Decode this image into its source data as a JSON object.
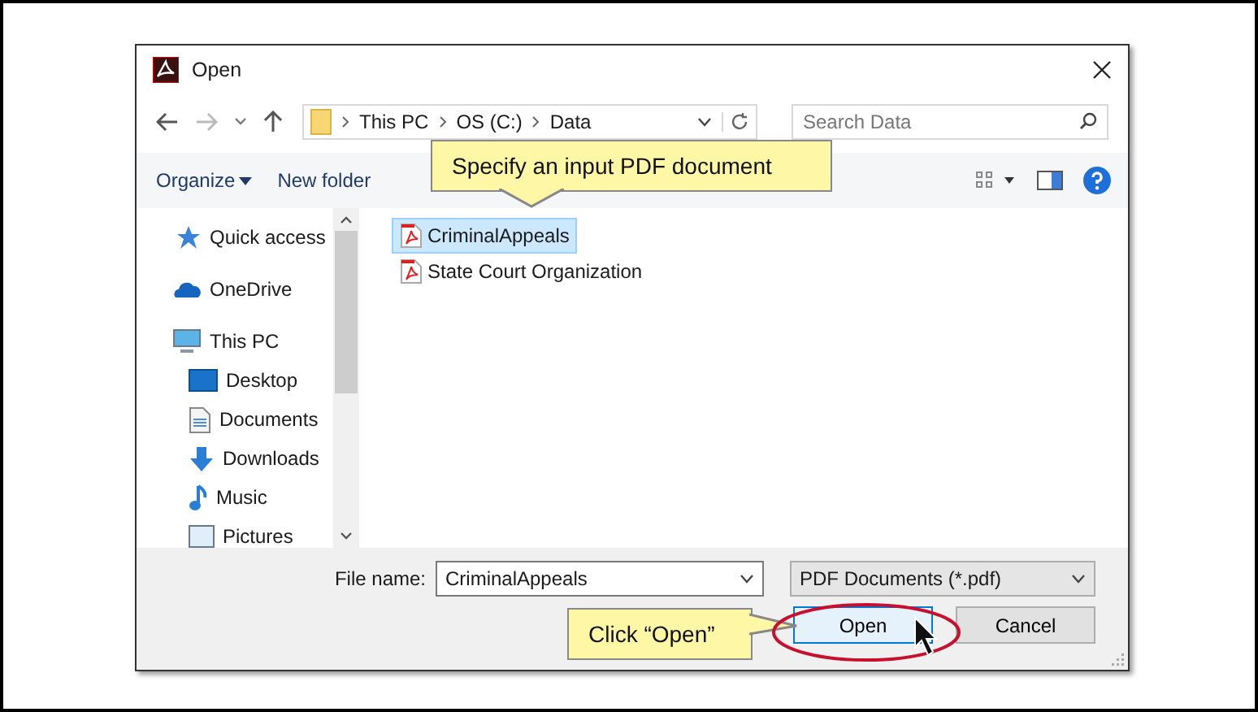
{
  "window": {
    "title": "Open"
  },
  "nav": {
    "breadcrumb": [
      "This PC",
      "OS (C:)",
      "Data"
    ],
    "search_placeholder": "Search Data"
  },
  "toolbar": {
    "organize": "Organize",
    "new_folder": "New folder"
  },
  "sidebar": {
    "items": [
      {
        "kind": "star",
        "label": "Quick access"
      },
      {
        "kind": "cloud",
        "label": "OneDrive"
      },
      {
        "kind": "pc",
        "label": "This PC",
        "children": [
          {
            "kind": "desktop",
            "label": "Desktop"
          },
          {
            "kind": "document",
            "label": "Documents"
          },
          {
            "kind": "download",
            "label": "Downloads"
          },
          {
            "kind": "music",
            "label": "Music"
          },
          {
            "kind": "picture",
            "label": "Pictures"
          }
        ]
      }
    ]
  },
  "files": [
    {
      "name": "CriminalAppeals",
      "selected": true
    },
    {
      "name": "State Court Organization",
      "selected": false
    }
  ],
  "footer": {
    "file_name_label": "File name:",
    "file_name": "CriminalAppeals",
    "file_type": "PDF Documents (*.pdf)",
    "buttons": [
      {
        "label": "Open",
        "default": true
      },
      {
        "label": "Cancel",
        "default": false
      }
    ]
  },
  "callouts": [
    {
      "text": "Specify an input PDF document"
    },
    {
      "text": "Click “Open”"
    }
  ]
}
